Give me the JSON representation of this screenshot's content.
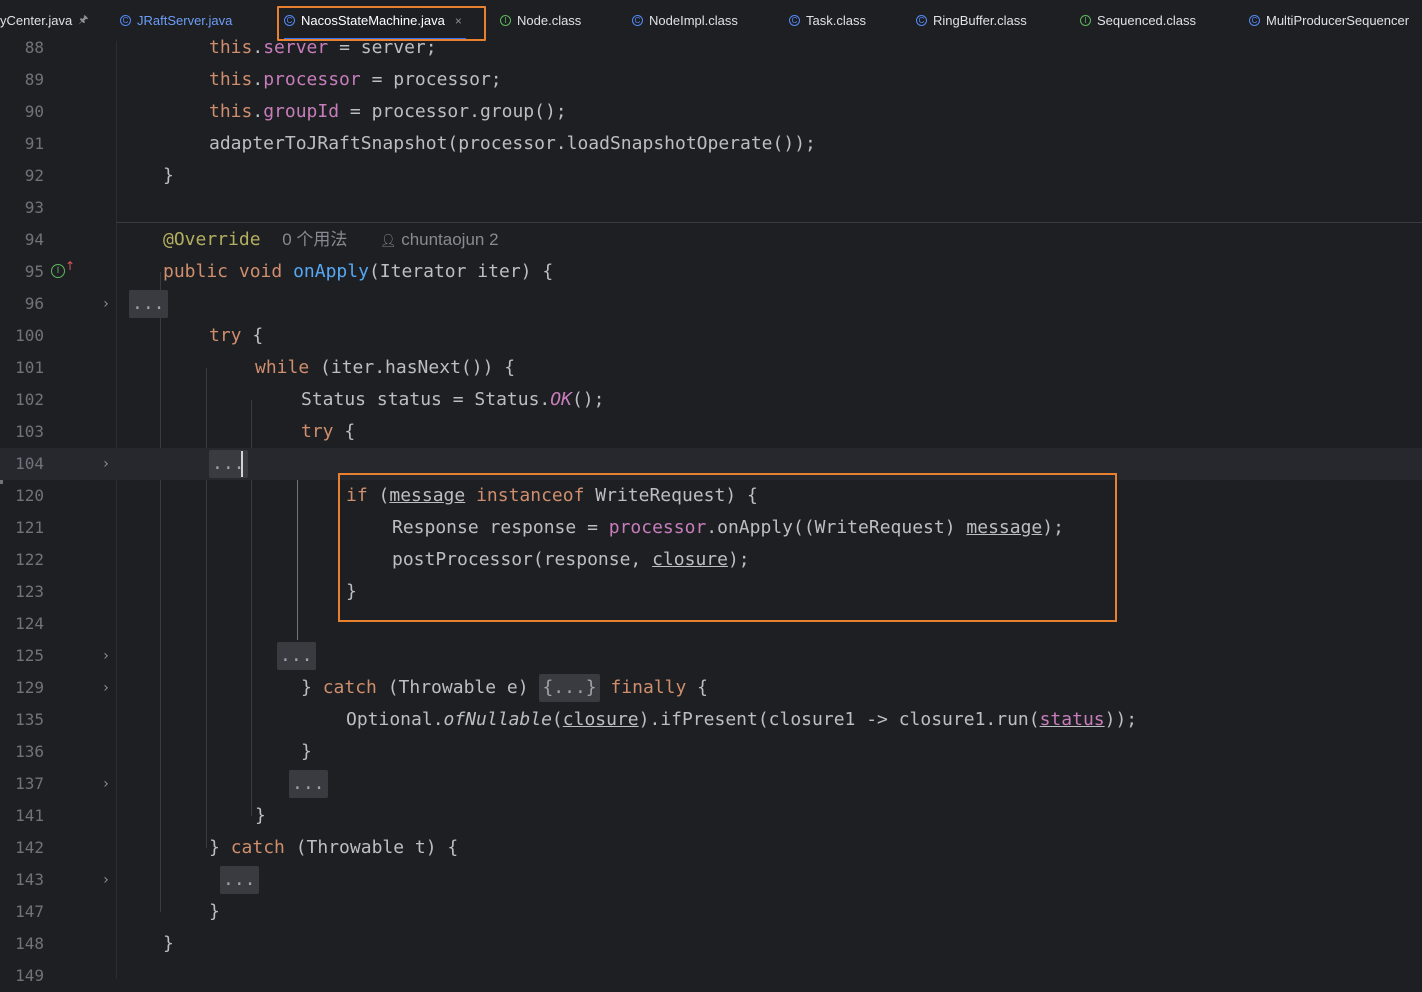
{
  "tabs": [
    {
      "label": "yCenter.java",
      "icon": "none",
      "pinned": true
    },
    {
      "label": "JRaftServer.java",
      "icon": "class"
    },
    {
      "label": "NacosStateMachine.java",
      "icon": "class",
      "active": true,
      "close": "×"
    },
    {
      "label": "Node.class",
      "icon": "interface"
    },
    {
      "label": "NodeImpl.class",
      "icon": "class"
    },
    {
      "label": "Task.class",
      "icon": "class"
    },
    {
      "label": "RingBuffer.class",
      "icon": "class"
    },
    {
      "label": "Sequenced.class",
      "icon": "interface"
    },
    {
      "label": "MultiProducerSequencer",
      "icon": "class"
    }
  ],
  "gutter": {
    "line_numbers": [
      "88",
      "89",
      "90",
      "91",
      "92",
      "93",
      "94",
      "95",
      "96",
      "100",
      "101",
      "102",
      "103",
      "104",
      "120",
      "121",
      "122",
      "123",
      "124",
      "125",
      "129",
      "135",
      "136",
      "137",
      "141",
      "142",
      "143",
      "147",
      "148",
      "149"
    ]
  },
  "code": {
    "this_kw": "this",
    "server_field": "server",
    "server_rest": " = server;",
    "processor_field": "processor",
    "processor_rest": " = processor;",
    "groupId_field": "groupId",
    "groupId_rest": " = processor.group();",
    "adapter_line": "adapterToJRaftSnapshot(processor.loadSnapshotOperate());",
    "close_brace": "}",
    "annotation": "@Override",
    "usages_hint": "0 个用法",
    "author_hint": "chuntaojun 2",
    "public_kw": "public",
    "void_kw": "void",
    "method_name": "onApply",
    "method_params": "(Iterator iter) {",
    "fold_placeholder": "...",
    "try_kw": "try",
    "open_brace": " {",
    "while_kw": "while",
    "while_rest": " (iter.hasNext()) {",
    "status_decl": "Status status = Status.",
    "status_ok": "OK",
    "status_end": "();",
    "if_kw": "if",
    "paren_open": " (",
    "message_var": "message",
    "instanceof_kw": "instanceof",
    "write_request_rest": " WriteRequest) {",
    "response_decl": "Response response = ",
    "processor_ref": "processor",
    "onapply_call": ".onApply((WriteRequest) ",
    "call_end": ");",
    "post_processor": "postProcessor(response, ",
    "closure_var": "closure",
    "close_brace_space": "} ",
    "catch_kw": "catch",
    "throwable_e": " (Throwable e) ",
    "fold_braced": "{...}",
    "finally_kw": "finally",
    "optional_start": "Optional.",
    "of_nullable": "ofNullable",
    "paren_left": "(",
    "if_present": ").ifPresent(closure1 -> closure1.run(",
    "status_var": "status",
    "double_paren_end": "));",
    "throwable_t": " (Throwable t) {"
  }
}
